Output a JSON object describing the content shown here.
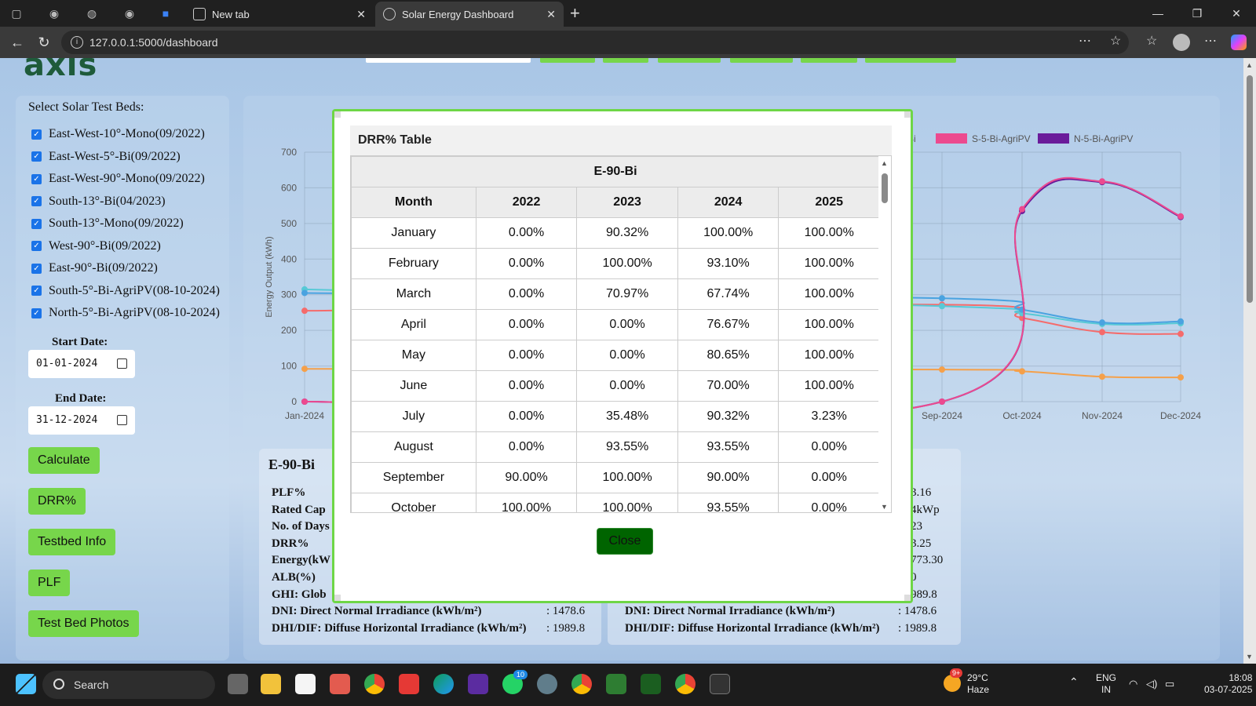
{
  "browser": {
    "tabs": [
      {
        "title": "New tab"
      },
      {
        "title": "Solar Energy Dashboard",
        "active": true
      }
    ],
    "url": "127.0.0.1:5000/dashboard",
    "win_controls": [
      "—",
      "❐",
      "✕"
    ]
  },
  "sidebar": {
    "select_title": "Select Solar Test Beds:",
    "beds": [
      "East-West-10°-Mono(09/2022)",
      "East-West-5°-Bi(09/2022)",
      "East-West-90°-Mono(09/2022)",
      "South-13°-Bi(04/2023)",
      "South-13°-Mono(09/2022)",
      "West-90°-Bi(09/2022)",
      "East-90°-Bi(09/2022)",
      "South-5°-Bi-AgriPV(08-10-2024)",
      "North-5°-Bi-AgriPV(08-10-2024)"
    ],
    "start_date_label": "Start Date:",
    "start_date": "01-01-2024",
    "end_date_label": "End Date:",
    "end_date": "31-12-2024",
    "buttons": [
      "Calculate",
      "DRR%",
      "Testbed Info",
      "PLF",
      "Test Bed Photos"
    ]
  },
  "chart_data": {
    "type": "line",
    "ylabel": "Energy Output (kWh)",
    "ylim": [
      0,
      700
    ],
    "yticks": [
      "0",
      "100",
      "200",
      "300",
      "400",
      "500",
      "600",
      "700"
    ],
    "categories": [
      "Jan-2024",
      "Sep-2024",
      "Oct-2024",
      "Nov-2024",
      "Dec-2024"
    ],
    "legend_visible": [
      {
        "name": "-Bi",
        "color": "#f28b8b"
      },
      {
        "name": "S-5-Bi-AgriPV",
        "color": "#ec4a8f"
      },
      {
        "name": "N-5-Bi-AgriPV",
        "color": "#6a1b9a"
      }
    ],
    "series": [
      {
        "name": "S-5-Bi-AgriPV",
        "color": "#ec4a8f",
        "values": [
          0,
          0,
          540,
          618,
          520
        ]
      },
      {
        "name": "N-5-Bi-AgriPV",
        "color": "#6a1b9a",
        "values": [
          0,
          0,
          535,
          616,
          518
        ]
      },
      {
        "color": "#4aa3e0",
        "values": [
          305,
          290,
          258,
          222,
          225
        ]
      },
      {
        "color": "#57c9d6",
        "values": [
          315,
          268,
          248,
          218,
          220
        ]
      },
      {
        "color": "#f56b6b",
        "values": [
          255,
          272,
          235,
          195,
          190
        ]
      },
      {
        "color": "#f5a04a",
        "values": [
          92,
          90,
          85,
          70,
          68
        ]
      }
    ]
  },
  "stats_left": {
    "title": "E-90-Bi",
    "rows": [
      {
        "label": "PLF%",
        "value": ""
      },
      {
        "label": "Rated Cap",
        "value": ""
      },
      {
        "label": "No. of Days",
        "value": ""
      },
      {
        "label": "DRR%",
        "value": ""
      },
      {
        "label": "Energy(kW",
        "value": ""
      },
      {
        "label": "ALB(%)",
        "value": ""
      },
      {
        "label": "GHI: Glob",
        "value": ""
      },
      {
        "label": "DNI: Direct Normal Irradiance (kWh/m²)",
        "value": ": 1478.6"
      },
      {
        "label": "DHI/DIF: Diffuse Horizontal Irradiance (kWh/m²)",
        "value": ": 1989.8"
      }
    ]
  },
  "stats_right": {
    "values": [
      "3.16",
      "4kWp",
      "23",
      "3.25",
      "773.30",
      "0",
      "989.8"
    ],
    "rows": [
      {
        "label": "DNI: Direct Normal Irradiance (kWh/m²)",
        "value": ": 1478.6"
      },
      {
        "label": "DHI/DIF: Diffuse Horizontal Irradiance (kWh/m²)",
        "value": ": 1989.8"
      }
    ]
  },
  "modal": {
    "title": "DRR% Table",
    "table_title": "E-90-Bi",
    "columns": [
      "Month",
      "2022",
      "2023",
      "2024",
      "2025"
    ],
    "rows": [
      [
        "January",
        "0.00%",
        "90.32%",
        "100.00%",
        "100.00%"
      ],
      [
        "February",
        "0.00%",
        "100.00%",
        "93.10%",
        "100.00%"
      ],
      [
        "March",
        "0.00%",
        "70.97%",
        "67.74%",
        "100.00%"
      ],
      [
        "April",
        "0.00%",
        "0.00%",
        "76.67%",
        "100.00%"
      ],
      [
        "May",
        "0.00%",
        "0.00%",
        "80.65%",
        "100.00%"
      ],
      [
        "June",
        "0.00%",
        "0.00%",
        "70.00%",
        "100.00%"
      ],
      [
        "July",
        "0.00%",
        "35.48%",
        "90.32%",
        "3.23%"
      ],
      [
        "August",
        "0.00%",
        "93.55%",
        "93.55%",
        "0.00%"
      ],
      [
        "September",
        "90.00%",
        "100.00%",
        "90.00%",
        "0.00%"
      ],
      [
        "October",
        "100.00%",
        "100.00%",
        "93.55%",
        "0.00%"
      ]
    ],
    "close_label": "Close"
  },
  "taskbar": {
    "search_label": "Search",
    "weather_temp": "29°C",
    "weather_desc": "Haze",
    "lang_line1": "ENG",
    "lang_line2": "IN",
    "time": "18:08",
    "date": "03-07-2025",
    "badges": {
      "whatsapp": "10",
      "weather": "9+"
    }
  }
}
